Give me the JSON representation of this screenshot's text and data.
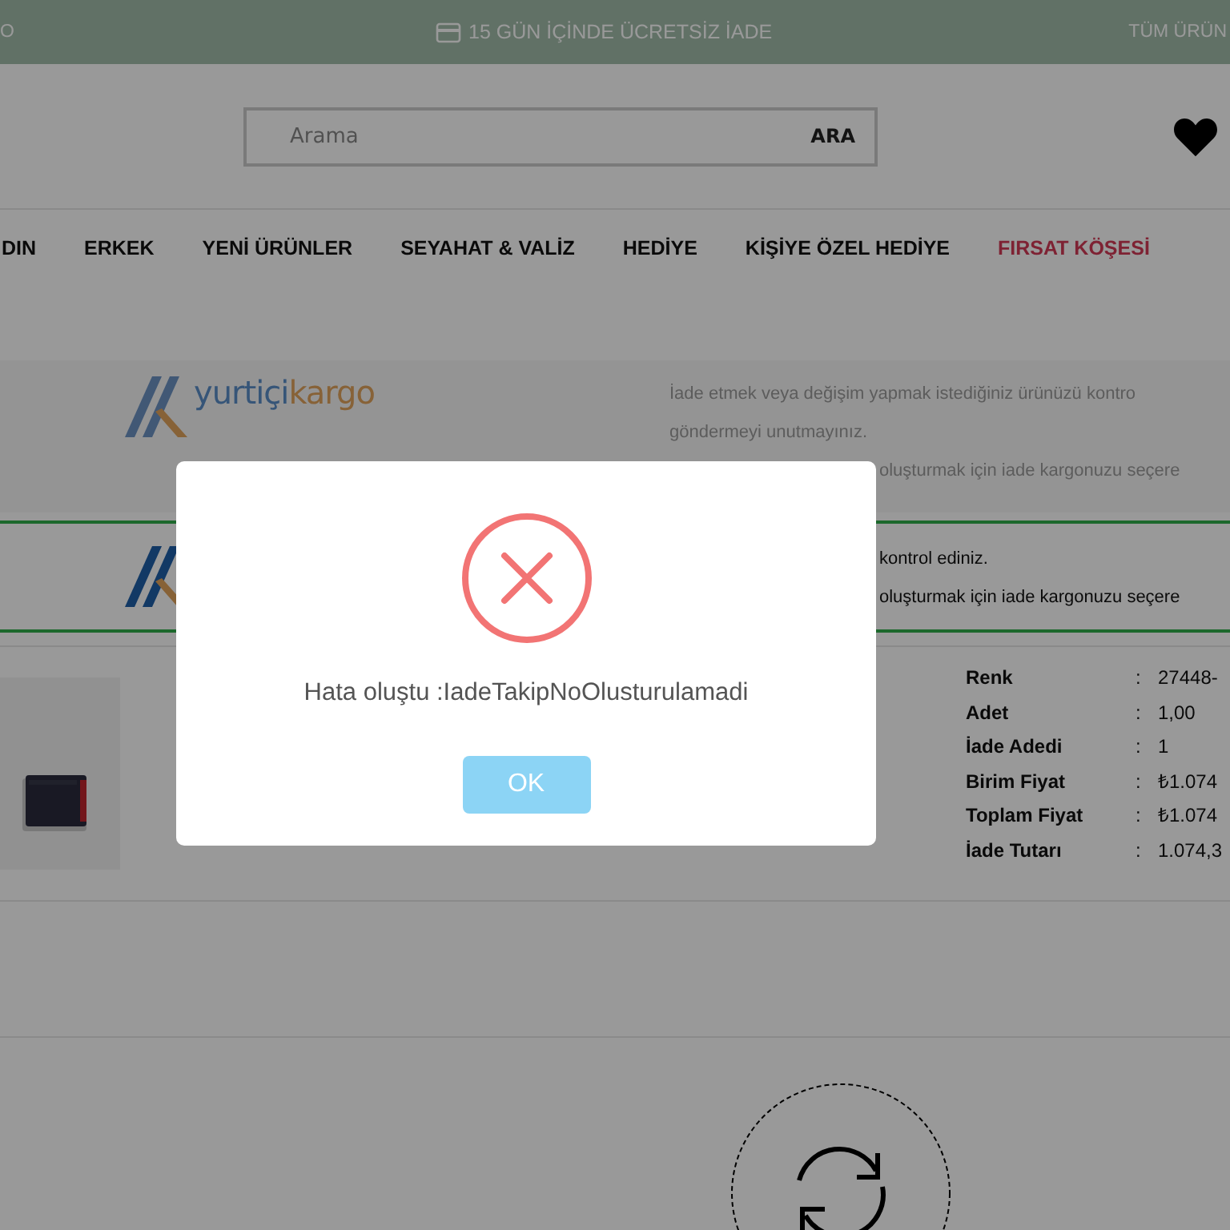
{
  "announcement_bar": {
    "left": "O",
    "center": "15 GÜN İÇİNDE ÜCRETSİZ İADE",
    "right": "TÜM ÜRÜN"
  },
  "search": {
    "placeholder": "Arama",
    "button": "ARA"
  },
  "nav": [
    {
      "label": "DIN",
      "highlight": false
    },
    {
      "label": "ERKEK",
      "highlight": false
    },
    {
      "label": "YENİ ÜRÜNLER",
      "highlight": false
    },
    {
      "label": "SEYAHAT & VALİZ",
      "highlight": false
    },
    {
      "label": "HEDİYE",
      "highlight": false
    },
    {
      "label": "KİŞİYE ÖZEL HEDİYE",
      "highlight": false
    },
    {
      "label": "FIRSAT KÖŞESİ",
      "highlight": true
    }
  ],
  "cargo_options": [
    {
      "selected": false,
      "logo": {
        "primary": "yurtiçi",
        "secondary": "kargo"
      },
      "lines": [
        "İade etmek veya değişim yapmak istediğiniz ürünüzü kontro",
        "göndermeyi unutmayınız."
      ],
      "hidden_start_line": "oluşturmak için iade kargonuzu seçere"
    },
    {
      "selected": true,
      "hidden_start_line": "kontrol ediniz.",
      "hidden_start_line_2": "oluşturmak için iade kargonuzu seçere"
    }
  ],
  "return_item": {
    "details": [
      {
        "label": "Renk",
        "separator": ":",
        "value": "27448-"
      },
      {
        "label": "Adet",
        "separator": ":",
        "value": "1,00"
      },
      {
        "label": "İade Adedi",
        "separator": ":",
        "value": "1"
      },
      {
        "label": "Birim Fiyat",
        "separator": ":",
        "value": "₺1.074"
      },
      {
        "label": "Toplam Fiyat",
        "separator": ":",
        "value": "₺1.074"
      },
      {
        "label": "İade Tutarı",
        "separator": ":",
        "value": "1.074,3"
      }
    ]
  },
  "dialog": {
    "message": "Hata oluştu :IadeTakipNoOlusturulamadi",
    "button": "OK"
  }
}
